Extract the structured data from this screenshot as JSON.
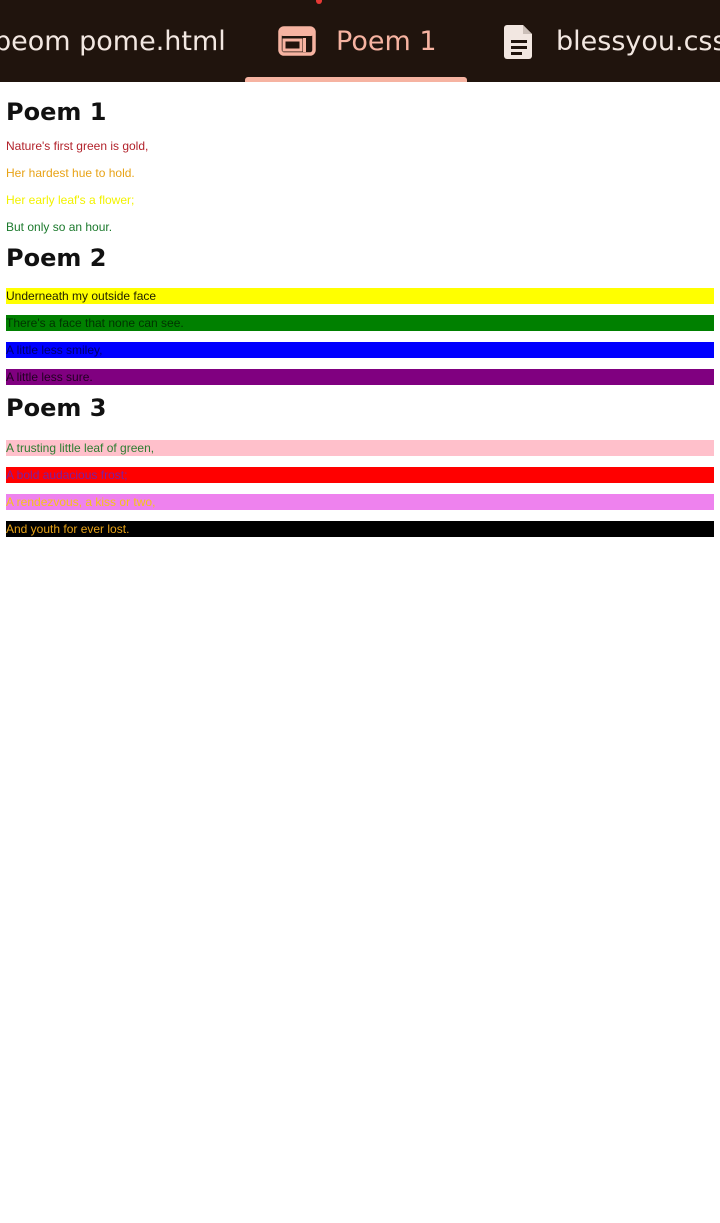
{
  "tabs": [
    {
      "label": "peom pome.html",
      "icon": "none"
    },
    {
      "label": "Poem 1",
      "icon": "web-layout-icon",
      "active": true
    },
    {
      "label": "blessyou.css",
      "icon": "document-icon"
    }
  ],
  "colors": {
    "topbar_bg": "#20140d",
    "active_tab": "#f6b3a1",
    "tab_text": "#f2e7e1",
    "indicator_dot": "#e53935"
  },
  "poems": [
    {
      "title": "Poem 1",
      "lines": [
        {
          "text": "Nature's first green is gold,",
          "color": "#b2222b",
          "bg": ""
        },
        {
          "text": "Her hardest hue to hold.",
          "color": "#e8a317",
          "bg": ""
        },
        {
          "text": "Her early leaf's a flower;",
          "color": "#f2f200",
          "bg": ""
        },
        {
          "text": "But only so an hour.",
          "color": "#1c7a2d",
          "bg": ""
        }
      ]
    },
    {
      "title": "Poem 2",
      "lines": [
        {
          "text": "Underneath my outside face",
          "color": "#222200",
          "bg": "#ffff00"
        },
        {
          "text": "There's a face that none can see.",
          "color": "#003300",
          "bg": "#008000"
        },
        {
          "text": "A little less smiley,",
          "color": "#000066",
          "bg": "#0000ff"
        },
        {
          "text": "A little less sure.",
          "color": "#220022",
          "bg": "#800080"
        }
      ]
    },
    {
      "title": "Poem 3",
      "lines": [
        {
          "text": "A trusting little leaf of green,",
          "color": "#2e7d32",
          "bg": "#ffc0cb"
        },
        {
          "text": "A bold audacious frost;",
          "color": "#7b1fa2",
          "bg": "#ff0000"
        },
        {
          "text": "A rendezvous, a kiss or two,",
          "color": "#f5c518",
          "bg": "#ee82ee"
        },
        {
          "text": "And youth for ever lost.",
          "color": "#e8a317",
          "bg": "#000000"
        }
      ]
    }
  ]
}
